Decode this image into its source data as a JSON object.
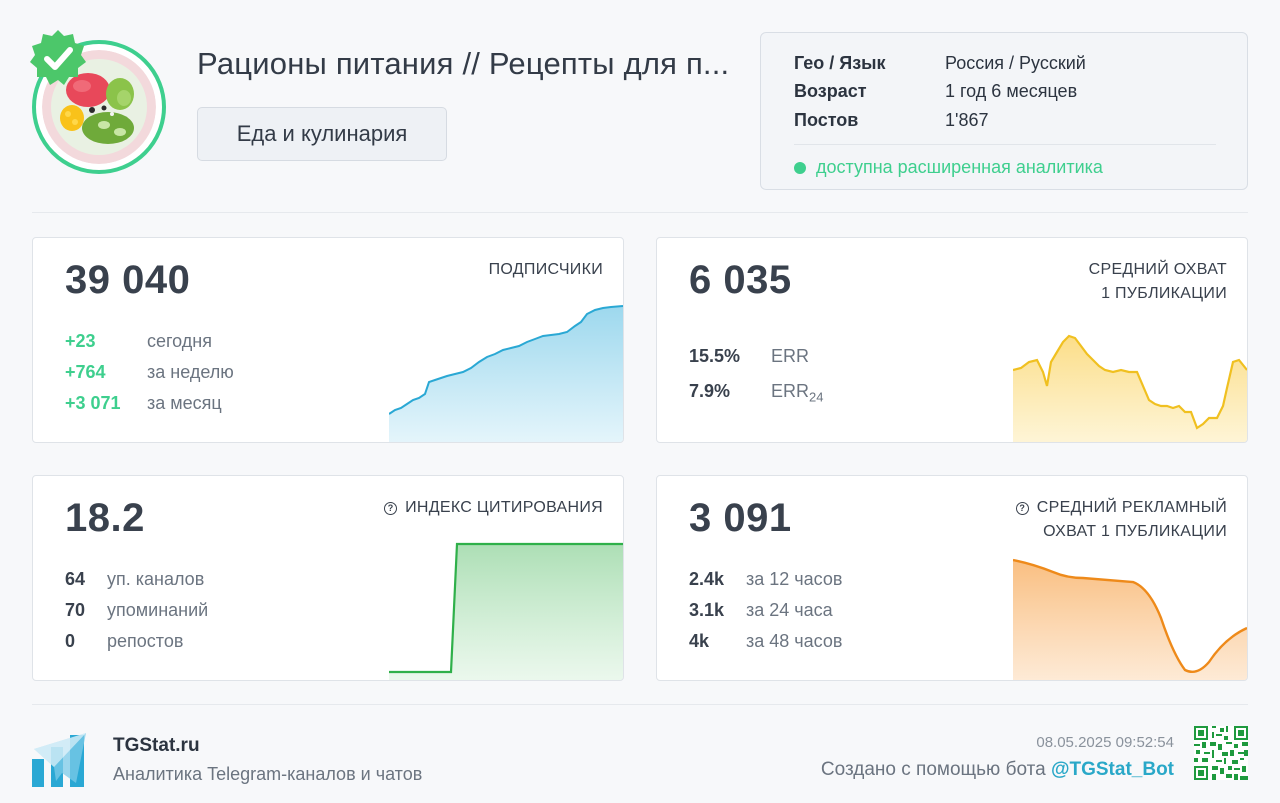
{
  "channel": {
    "title": "Рационы питания // Рецепты для п...",
    "category": "Еда и кулинария"
  },
  "info": {
    "rows": [
      {
        "key": "Гео / Язык",
        "value": "Россия / Русский"
      },
      {
        "key": "Возраст",
        "value": "1 год 6 месяцев"
      },
      {
        "key": "Постов",
        "value": "1'867"
      }
    ],
    "status": "доступна расширенная аналитика"
  },
  "cards": {
    "subscribers": {
      "value": "39 040",
      "label": "ПОДПИСЧИКИ",
      "stats": [
        {
          "num": "+23",
          "text": "сегодня"
        },
        {
          "num": "+764",
          "text": "за неделю"
        },
        {
          "num": "+3 071",
          "text": "за месяц"
        }
      ]
    },
    "reach": {
      "value": "6 035",
      "label_line1": "СРЕДНИЙ ОХВАТ",
      "label_line2": "1 ПУБЛИКАЦИИ",
      "stats": [
        {
          "num": "15.5%",
          "text": "ERR",
          "sub": ""
        },
        {
          "num": "7.9%",
          "text": "ERR",
          "sub": "24"
        }
      ]
    },
    "citation": {
      "value": "18.2",
      "label": "ИНДЕКС ЦИТИРОВАНИЯ",
      "stats": [
        {
          "num": "64",
          "text": "уп. каналов"
        },
        {
          "num": "70",
          "text": "упоминаний"
        },
        {
          "num": "0",
          "text": "репостов"
        }
      ]
    },
    "ad_reach": {
      "value": "3 091",
      "label_line1": "СРЕДНИЙ РЕКЛАМНЫЙ",
      "label_line2": "ОХВАТ 1 ПУБЛИКАЦИИ",
      "stats": [
        {
          "num": "2.4k",
          "text": "за 12 часов"
        },
        {
          "num": "3.1k",
          "text": "за 24 часа"
        },
        {
          "num": "4k",
          "text": "за 48 часов"
        }
      ]
    }
  },
  "footer": {
    "site": "TGStat.ru",
    "tagline": "Аналитика Telegram-каналов и чатов",
    "date": "08.05.2025 09:52:54",
    "bot_prefix": "Создано с помощью бота ",
    "bot_handle": "@TGStat_Bot"
  },
  "colors": {
    "accent_green": "#3ecf8e",
    "subscribers_line": "#2aa8d4",
    "reach_line": "#f0c020",
    "citation_line": "#2fb04a",
    "ad_reach_line": "#ee8a1a",
    "bot_link": "#2aa8c8"
  },
  "icons": [
    "verified-badge-icon",
    "help-icon",
    "tgstat-logo-icon",
    "qr-code-icon",
    "status-dot-icon"
  ]
}
